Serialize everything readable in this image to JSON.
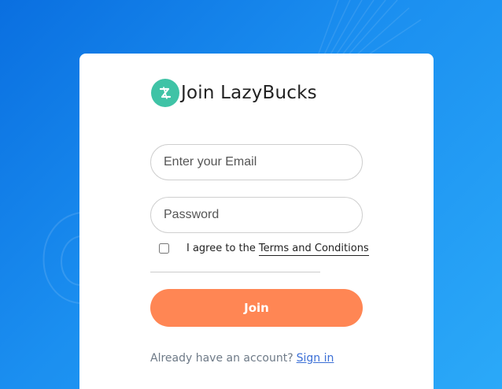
{
  "brand": {
    "title": "Join LazyBucks",
    "logo_icon": "lazybucks-logo-icon"
  },
  "form": {
    "email_placeholder": "Enter your Email",
    "password_placeholder": "Password",
    "email_value": "",
    "password_value": "",
    "agree_prefix": "I agree to the",
    "terms_link": "Terms and Conditions",
    "agree_checked": false,
    "join_label": "Join"
  },
  "footer": {
    "prompt": "Already have an account?",
    "signin_link": "Sign in"
  },
  "colors": {
    "accent": "#ff8654",
    "logo": "#3fc3a6",
    "link": "#3b6fd6",
    "background_start": "#0a6fe0",
    "background_end": "#2ba9f8"
  }
}
